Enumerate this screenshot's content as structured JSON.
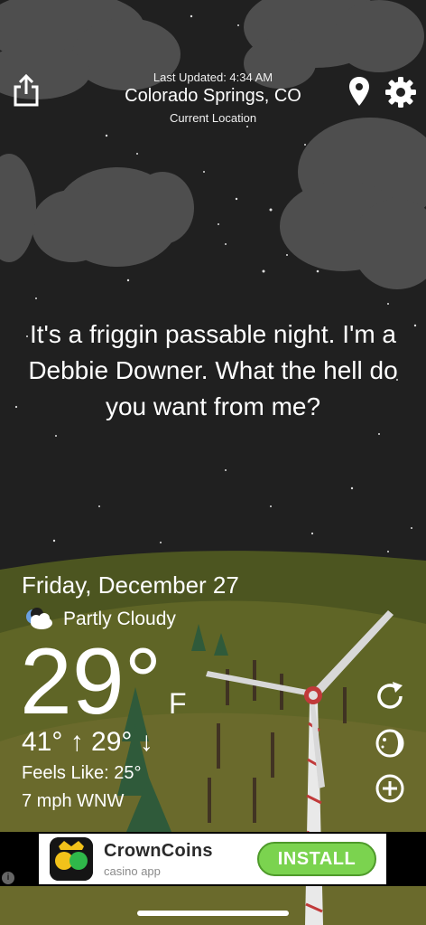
{
  "header": {
    "last_updated": "Last Updated: 4:34 AM",
    "city": "Colorado Springs, CO",
    "location_label": "Current Location",
    "share_icon": "share-icon",
    "location_icon": "location-pin-icon",
    "settings_icon": "gear-icon"
  },
  "snark": "It's a friggin passable night. I'm a Debbie Downer. What the hell do you want from me?",
  "weather": {
    "date": "Friday, December 27",
    "condition": "Partly Cloudy",
    "condition_icon": "partly-cloudy-night-icon",
    "temperature": "29°",
    "unit": "F",
    "high_low": "41° ↑ 29° ↓",
    "feels_like": "Feels Like: 25°",
    "wind": "7 mph WNW"
  },
  "side_buttons": {
    "refresh_icon": "refresh-icon",
    "moon_icon": "moon-phase-icon",
    "add_icon": "add-icon"
  },
  "ad": {
    "brand": "CrownCoins",
    "subtitle": "casino app",
    "cta": "INSTALL",
    "info": "i"
  },
  "colors": {
    "sky": "#1e1e1e",
    "cloud": "#555555",
    "hill": "#5a5d26",
    "install_green": "#7bd34f"
  }
}
